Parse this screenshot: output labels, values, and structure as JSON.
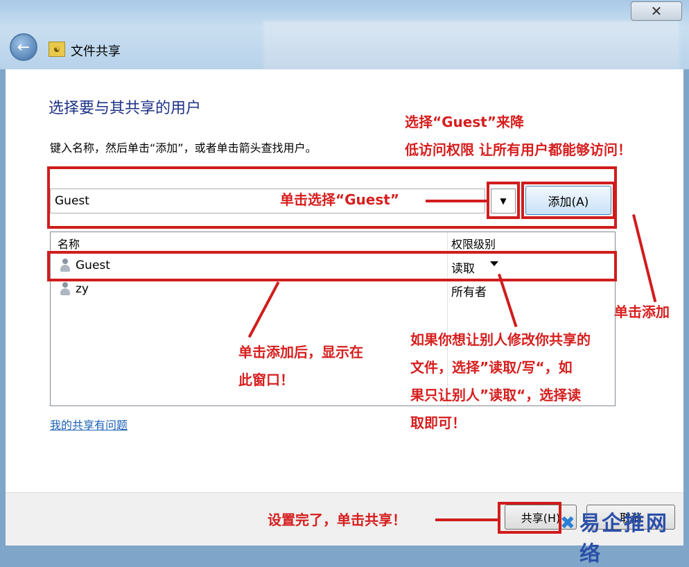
{
  "window": {
    "title": "文件共享",
    "close_label": "✕"
  },
  "dialog": {
    "heading": "选择要与其共享的用户",
    "instruction": "键入名称，然后单击“添加”，或者单击箭头查找用户。",
    "input_value": "Guest",
    "add_button": "添加(A)",
    "columns": {
      "name": "名称",
      "permission": "权限级别"
    },
    "rows": [
      {
        "name": "Guest",
        "permission": "读取"
      },
      {
        "name": "zy",
        "permission": "所有者"
      }
    ],
    "help_link": "我的共享有问题",
    "share_button": "共享(H)",
    "cancel_button": "取消"
  },
  "annotations": {
    "top_right_line1": "选择“Guest”来降",
    "top_right_line2": "低访问权限 让所有用户都能够访问！",
    "select_guest": "单击选择“Guest”",
    "click_add": "单击添加",
    "after_add_line1": "单击添加后，显示在",
    "after_add_line2": "此窗口！",
    "modify_line1": "如果你想让别人修改你共享的",
    "modify_line2": "文件，选择”读取/写“，如",
    "modify_line3": "果只让别人”读取“，选择读",
    "modify_line4": "取即可！",
    "done_share": "设置完了，单击共享！"
  },
  "watermark": "易企推网络",
  "colors": {
    "annotation": "#d01c1c",
    "heading": "#1e3287",
    "link": "#1a5fb4"
  }
}
